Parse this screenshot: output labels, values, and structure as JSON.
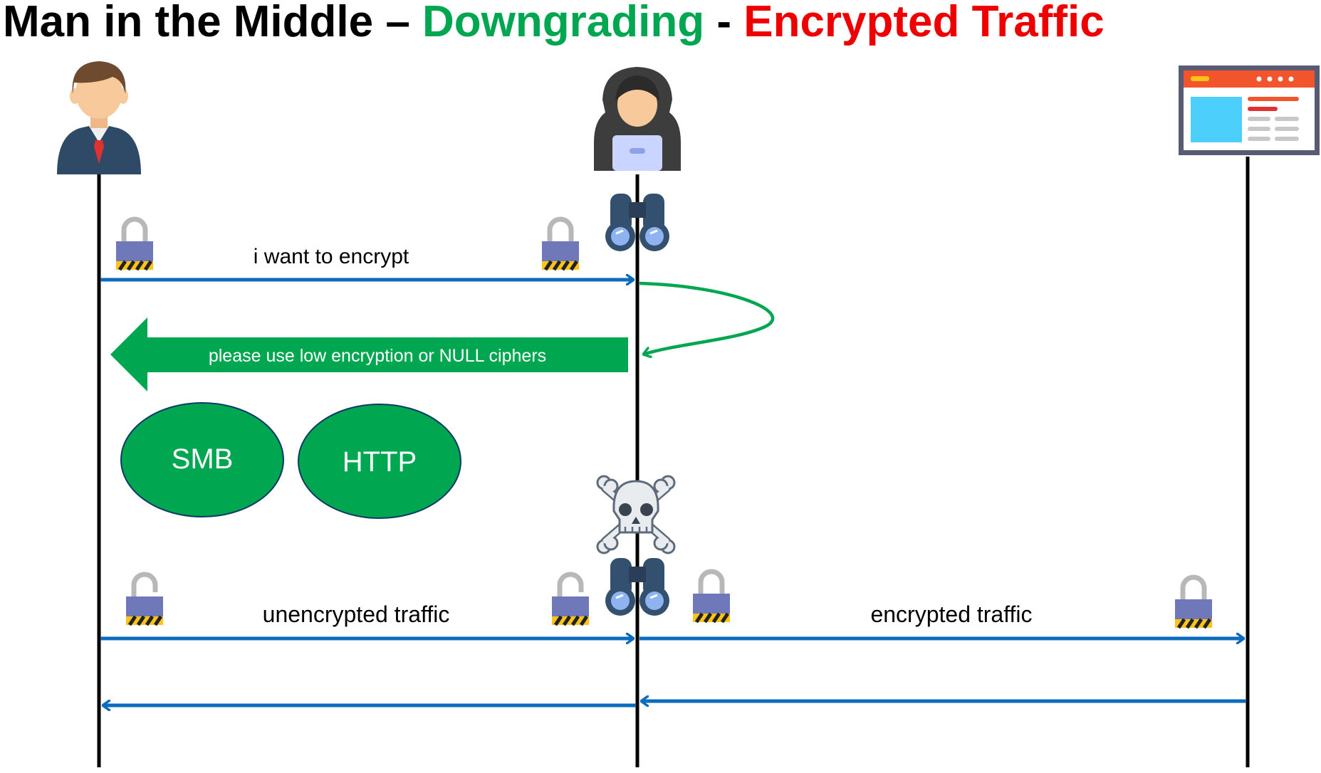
{
  "title": {
    "part1": "Man in the Middle – ",
    "part2": "Downgrading",
    "part3": " - ",
    "part4": "Encrypted Traffic"
  },
  "actors": {
    "client": "person-icon",
    "attacker": "hooded-hacker-icon",
    "server": "web-page-icon"
  },
  "messages": {
    "encrypt_request": "i want to encrypt",
    "downgrade": "please use low encryption or NULL ciphers",
    "unencrypted": "unencrypted traffic",
    "encrypted": "encrypted traffic"
  },
  "protocols": {
    "smb": "SMB",
    "http": "HTTP"
  },
  "colors": {
    "green": "#00a650",
    "red": "#ee0000",
    "blue": "#0b6bbd",
    "lock": "#6f78b9"
  }
}
